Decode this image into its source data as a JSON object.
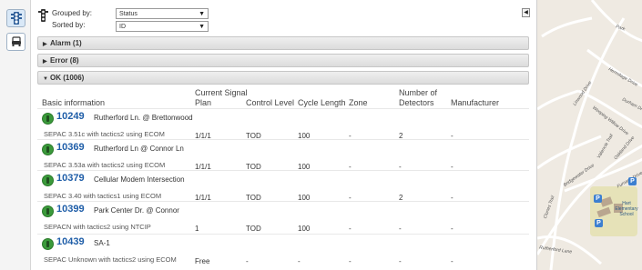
{
  "grouping": {
    "grouped_by_label": "Grouped by:",
    "grouped_by_value": "Status",
    "sorted_by_label": "Sorted by:",
    "sorted_by_value": "ID"
  },
  "groups": {
    "alarm": "Alarm (1)",
    "error": "Error (8)",
    "ok": "OK (1006)"
  },
  "columns": {
    "basic": "Basic information",
    "plan_line1": "Current Signal",
    "plan_line2": "Plan",
    "control": "Control Level",
    "cycle": "Cycle Length",
    "zone": "Zone",
    "detectors_line1": "Number of",
    "detectors_line2": "Detectors",
    "manufacturer": "Manufacturer"
  },
  "rows": [
    {
      "id": "10249",
      "name": "Rutherford Ln. @ Brettonwood",
      "sub": "SEPAC 3.51c with tactics2 using ECOM",
      "plan": "1/1/1",
      "control": "TOD",
      "cycle": "100",
      "zone": "-",
      "detectors": "2",
      "manufacturer": "-"
    },
    {
      "id": "10369",
      "name": "Rutherford Ln @ Connor Ln",
      "sub": "SEPAC 3.53a with tactics2 using ECOM",
      "plan": "1/1/1",
      "control": "TOD",
      "cycle": "100",
      "zone": "-",
      "detectors": "-",
      "manufacturer": "-"
    },
    {
      "id": "10379",
      "name": "Cellular Modem Intersection",
      "sub": "SEPAC 3.40 with tactics1 using ECOM",
      "plan": "1/1/1",
      "control": "TOD",
      "cycle": "100",
      "zone": "-",
      "detectors": "2",
      "manufacturer": "-"
    },
    {
      "id": "10399",
      "name": "Park Center Dr. @ Connor",
      "sub": "SEPACN with tactics2 using NTCIP",
      "plan": "1",
      "control": "TOD",
      "cycle": "100",
      "zone": "-",
      "detectors": "-",
      "manufacturer": "-"
    },
    {
      "id": "10439",
      "name": "SA-1",
      "sub": "SEPAC Unknown with tactics2 using ECOM",
      "plan": "Free",
      "control": "-",
      "cycle": "-",
      "zone": "-",
      "detectors": "-",
      "manufacturer": "-"
    }
  ],
  "map": {
    "streets": [
      "Park",
      "Hermitage Drive",
      "Durham Dr",
      "Weeping Willow Drive",
      "Linwood Drive",
      "Valencia Trail",
      "Oakland Drive",
      "Furnace Drive",
      "Bridgewater Drive",
      "Rutherford Lane",
      "Clunes Trail"
    ],
    "school": "Hart Elementary School",
    "parking_label": "P"
  },
  "colors": {
    "link_blue": "#1f5ea8",
    "status_ok_green": "#3b9a3b",
    "map_background": "#efeae2",
    "map_road": "#ffffff",
    "parking_blue": "#3c7fd0"
  },
  "icons": {
    "rail_top": "traffic-signal-icon",
    "rail_bottom": "vehicle-icon",
    "status": "traffic-signal-status-icon"
  }
}
